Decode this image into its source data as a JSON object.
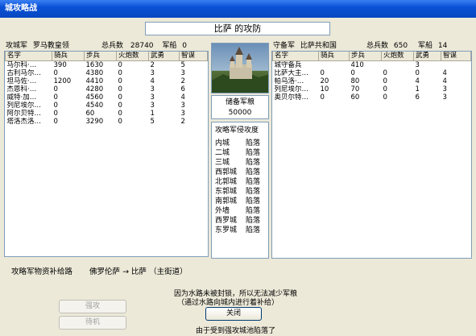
{
  "window": {
    "title": "城攻略战"
  },
  "battle_title": "比萨 的攻防",
  "attacker": {
    "label": "攻城军",
    "leader": "罗马教皇领",
    "total_label": "总兵数",
    "total": "28740",
    "ships_label": "军船",
    "ships": "0",
    "columns": [
      "名字",
      "骑兵",
      "步兵",
      "火炮数",
      "武勇",
      "智谋"
    ],
    "rows": [
      [
        "马尔科·…",
        "390",
        "1630",
        "0",
        "2",
        "5"
      ],
      [
        "古利马尔…",
        "0",
        "4380",
        "0",
        "3",
        "3"
      ],
      [
        "坦马佐·…",
        "1200",
        "4410",
        "0",
        "4",
        "2"
      ],
      [
        "杰恩科·…",
        "0",
        "4280",
        "0",
        "3",
        "6"
      ],
      [
        "威特·加…",
        "0",
        "4560",
        "0",
        "3",
        "4"
      ],
      [
        "列尼埃尔…",
        "0",
        "4540",
        "0",
        "3",
        "3"
      ],
      [
        "阿尔贝特…",
        "0",
        "60",
        "0",
        "1",
        "3"
      ],
      [
        "塔洛杰洛…",
        "0",
        "3290",
        "0",
        "5",
        "2"
      ]
    ]
  },
  "defender": {
    "label": "守备军",
    "leader": "比萨共和国",
    "total_label": "总兵数",
    "total": "650",
    "ships_label": "军船",
    "ships": "14",
    "columns": [
      "名字",
      "骑兵",
      "步兵",
      "火炮数",
      "武勇",
      "智谋"
    ],
    "rows": [
      [
        "城守备兵",
        "",
        "410",
        "",
        "3",
        ""
      ],
      [
        "比萨大主…",
        "0",
        "0",
        "0",
        "0",
        "4"
      ],
      [
        "帕乌洛·…",
        "20",
        "80",
        "0",
        "4",
        "4"
      ],
      [
        "列尼埃尔…",
        "10",
        "70",
        "0",
        "1",
        "3"
      ],
      [
        "奥贝尔特…",
        "0",
        "60",
        "0",
        "6",
        "3"
      ]
    ]
  },
  "supplies": {
    "label": "储备军粮",
    "value": "50000"
  },
  "progress": {
    "title": "攻略军侵攻度",
    "items": [
      [
        "内城",
        "陷落"
      ],
      [
        "二城",
        "陷落"
      ],
      [
        "三城",
        "陷落"
      ],
      [
        "西郭城",
        "陷落"
      ],
      [
        "北郭城",
        "陷落"
      ],
      [
        "东郭城",
        "陷落"
      ],
      [
        "南郭城",
        "陷落"
      ],
      [
        "外墙",
        "陷落"
      ],
      [
        "西罗城",
        "陷落"
      ],
      [
        "东罗城",
        "陷落"
      ]
    ]
  },
  "supply_route": {
    "label": "攻略军物资补给路",
    "route": "佛罗伦萨 → 比萨 （主街道）"
  },
  "messages": {
    "line1": "因为水路未被封锁，所以无法减少军粮",
    "line2": "（通过水路向城内进行着补给）",
    "result": "由于受到强攻城池陷落了"
  },
  "buttons": {
    "assault": "强攻",
    "wait": "待机",
    "close": "关闭"
  }
}
